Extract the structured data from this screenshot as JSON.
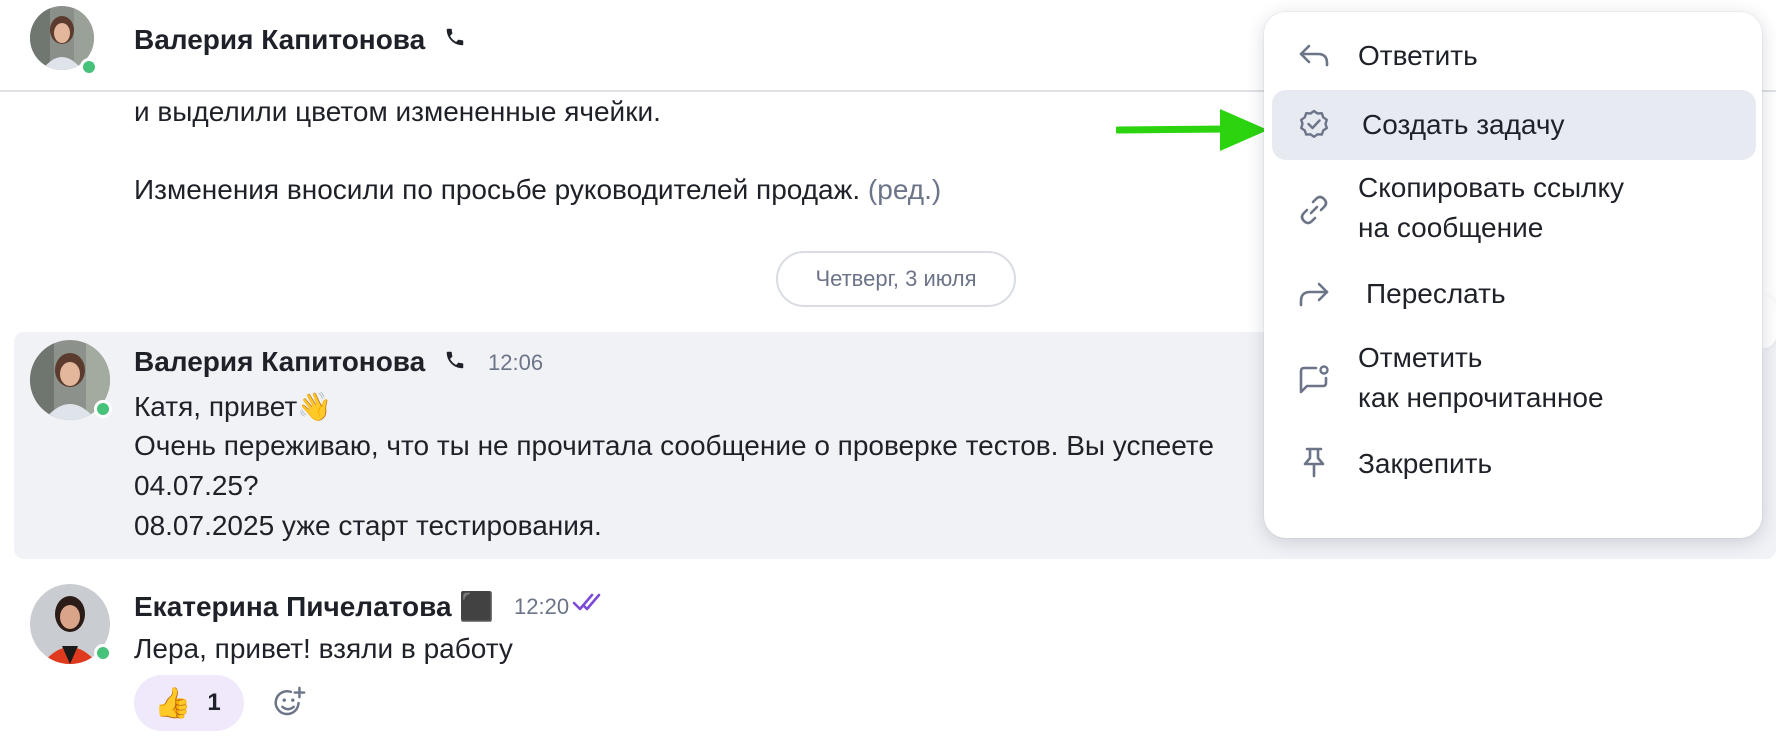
{
  "header": {
    "contact_name": "Валерия Капитонова"
  },
  "messages": {
    "prev_line_1": "и выделили цветом измененные ячейки.",
    "prev_line_2": "Изменения вносили по просьбе руководителей продаж.",
    "prev_edited": "(ред.)",
    "date_separator": "Четверг, 3 июля",
    "msg1": {
      "author": "Валерия Капитонова",
      "time": "12:06",
      "line_1": "Катя, привет👋",
      "line_2": "Очень переживаю, что ты не прочитала сообщение о проверке тестов. Вы успеете",
      "line_3": "04.07.25?",
      "line_4": "08.07.2025 уже старт тестирования."
    },
    "msg2": {
      "author": "Екатерина Пичелатова",
      "status_emoji": "⬛",
      "time": "12:20",
      "text": "Лера, привет! взяли в работу",
      "reaction_emoji": "👍",
      "reaction_count": "1"
    }
  },
  "context_menu": {
    "items": [
      {
        "label": "Ответить",
        "icon": "reply-icon"
      },
      {
        "label": "Создать задачу",
        "icon": "task-badge-icon"
      },
      {
        "label_line_1": "Скопировать ссылку",
        "label_line_2": "на сообщение",
        "icon": "link-icon"
      },
      {
        "label": "Переслать",
        "icon": "forward-icon"
      },
      {
        "label_line_1": "Отметить",
        "label_line_2": "как непрочитанное",
        "icon": "mark-unread-icon"
      },
      {
        "label": "Закрепить",
        "icon": "pin-icon"
      }
    ],
    "highlighted_index": 1
  },
  "colors": {
    "accent_arrow": "#2bd40f",
    "online": "#47c27a",
    "read_checks": "#7b4bd6",
    "menu_highlight": "#e8eaf1",
    "message_highlight": "#f1f2f6",
    "reaction_bg": "#efe9fb"
  }
}
